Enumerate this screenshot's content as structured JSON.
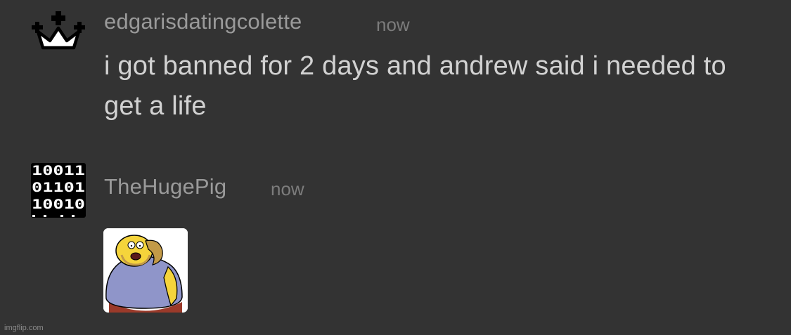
{
  "messages": [
    {
      "username": "edgarisdatingcolette",
      "timestamp": "now",
      "text": "i got banned for 2 days and andrew said i needed to get a life",
      "avatar_icon": "crown-icon"
    },
    {
      "username": "TheHugePig",
      "timestamp": "now",
      "avatar_icon": "binary-code-icon",
      "attachment": "cartoon-comic-book-guy-image"
    }
  ],
  "watermark": "imgflip.com",
  "colors": {
    "background": "#333333",
    "username": "#9a9a9a",
    "timestamp": "#7c7c7c",
    "message_text": "#d2d2d2"
  }
}
